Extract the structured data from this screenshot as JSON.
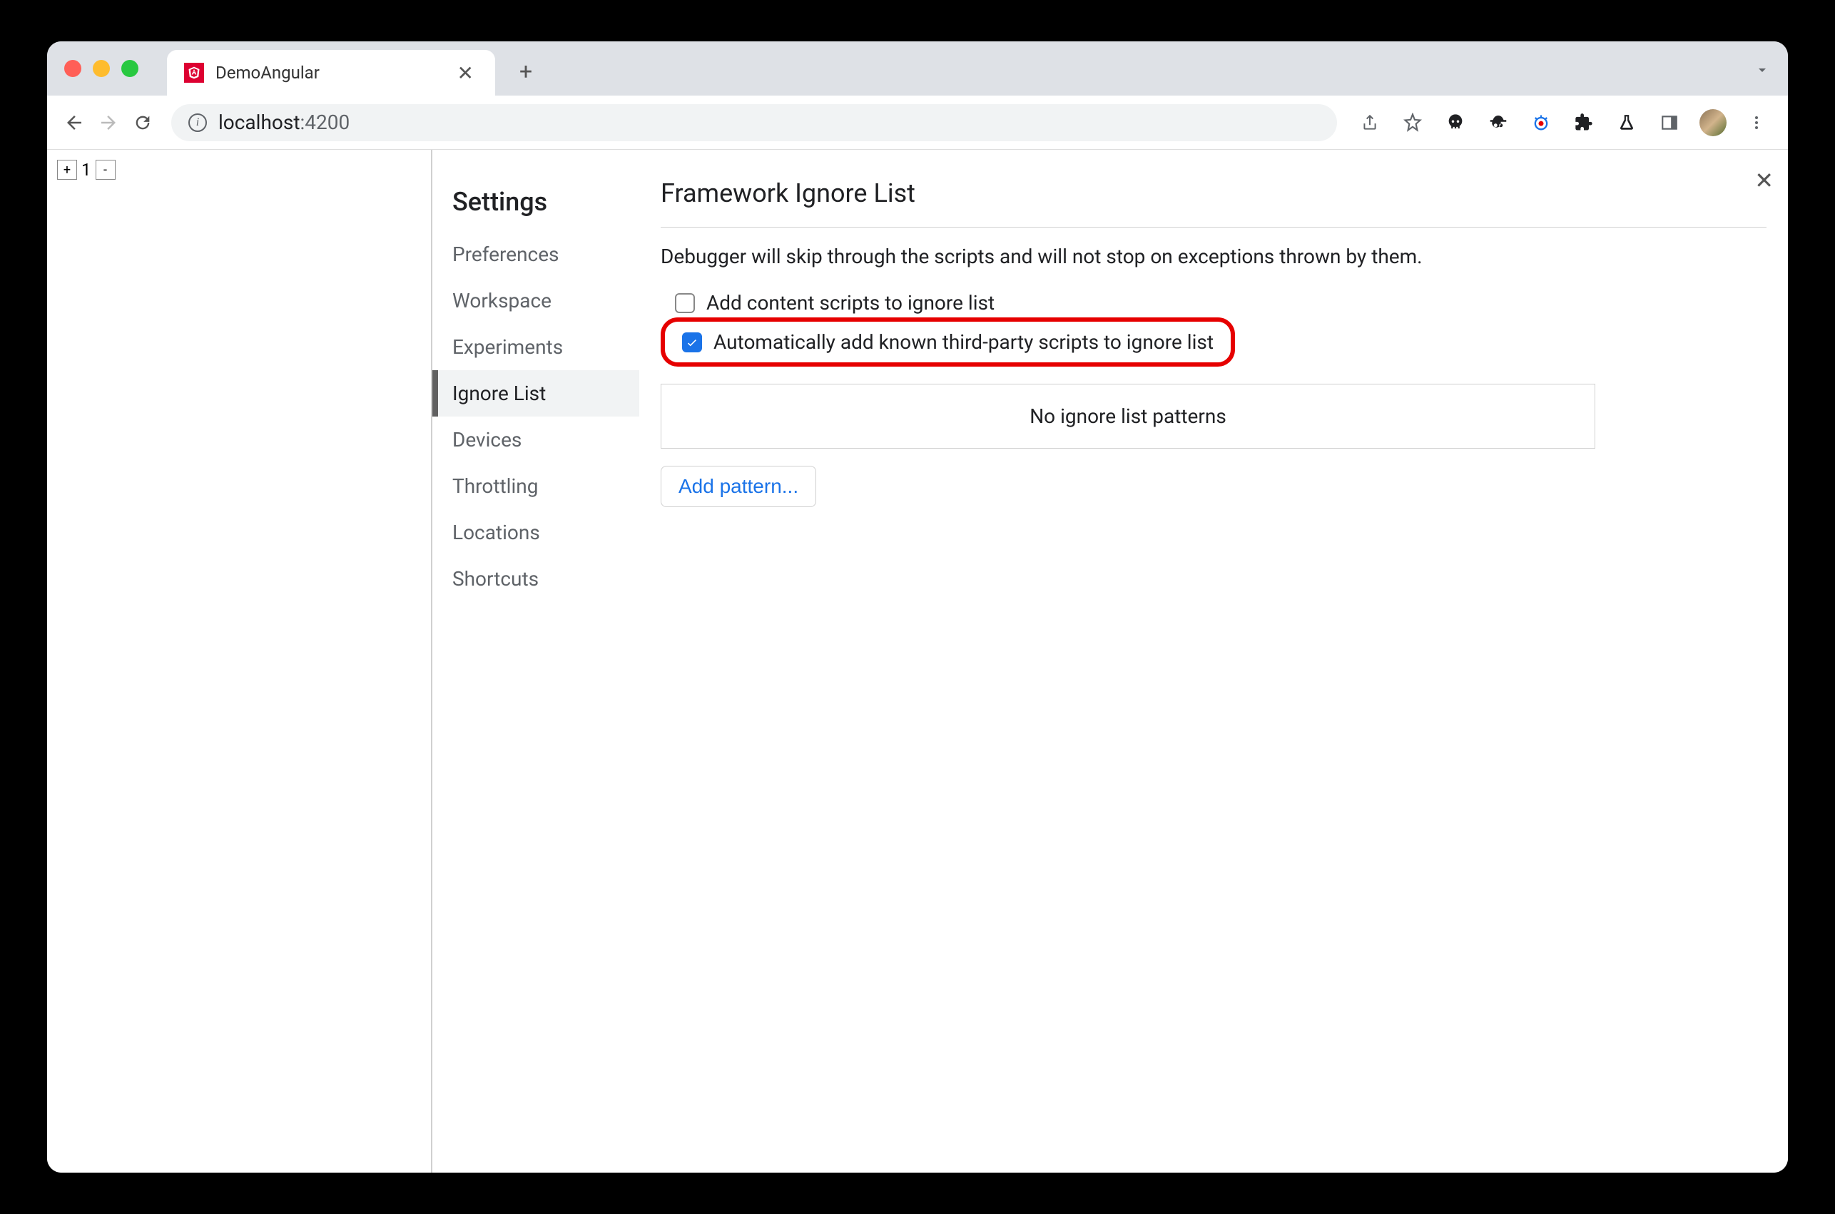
{
  "browser": {
    "tab_title": "DemoAngular",
    "url_host": "localhost",
    "url_port": ":4200"
  },
  "page": {
    "counter_value": "1",
    "plus_label": "+",
    "minus_label": "-"
  },
  "settings": {
    "title": "Settings",
    "nav": [
      "Preferences",
      "Workspace",
      "Experiments",
      "Ignore List",
      "Devices",
      "Throttling",
      "Locations",
      "Shortcuts"
    ],
    "active_index": 3
  },
  "panel": {
    "title": "Framework Ignore List",
    "description": "Debugger will skip through the scripts and will not stop on exceptions thrown by them.",
    "checkbox1_label": "Add content scripts to ignore list",
    "checkbox1_checked": false,
    "checkbox2_label": "Automatically add known third-party scripts to ignore list",
    "checkbox2_checked": true,
    "empty_list_text": "No ignore list patterns",
    "add_pattern_label": "Add pattern..."
  }
}
